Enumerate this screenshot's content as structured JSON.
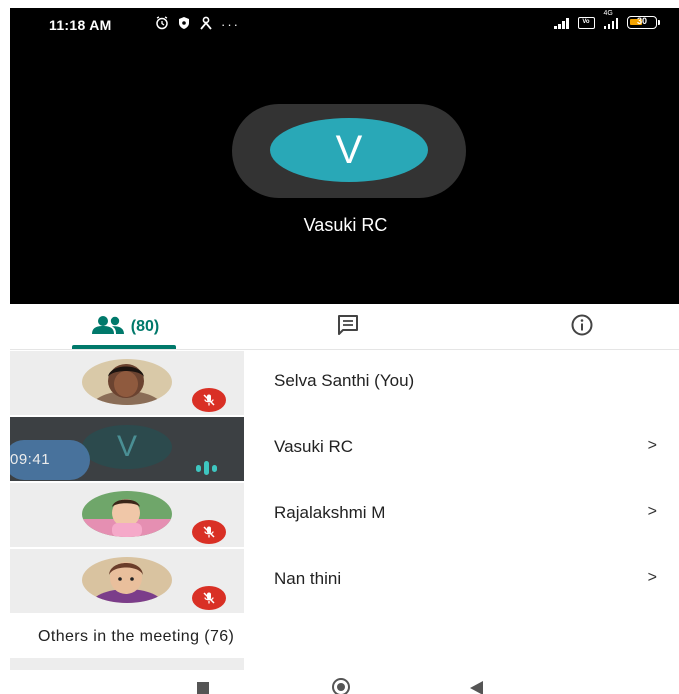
{
  "status_bar": {
    "time": "11:18 AM",
    "icons": [
      "alarm-icon",
      "shield-icon",
      "person-icon",
      "more-dots-icon"
    ],
    "network_label": "4G",
    "volte_label": "Vo",
    "battery_level": "30"
  },
  "stage": {
    "avatar_letter": "V",
    "speaker_name": "Vasuki RC"
  },
  "tabs": {
    "people_count": "(80)",
    "active": "people"
  },
  "participants": [
    {
      "name": "Selva Santhi (You)",
      "muted": true,
      "has_chevron": false
    },
    {
      "name": "Vasuki RC",
      "muted": false,
      "speaking": true,
      "avatar_letter": "V",
      "timer": "09:41",
      "has_chevron": true,
      "chevron": ">"
    },
    {
      "name": "Rajalakshmi M",
      "muted": true,
      "has_chevron": true,
      "chevron": ">"
    },
    {
      "name": "Nan thini",
      "muted": true,
      "has_chevron": true,
      "chevron": ">"
    }
  ],
  "others": {
    "label": "Others in the meeting (76)"
  },
  "colors": {
    "accent": "#00796b",
    "avatar_bg": "#29a8b7",
    "muted_red": "#d93025",
    "speaking": "#3ec6c0"
  }
}
